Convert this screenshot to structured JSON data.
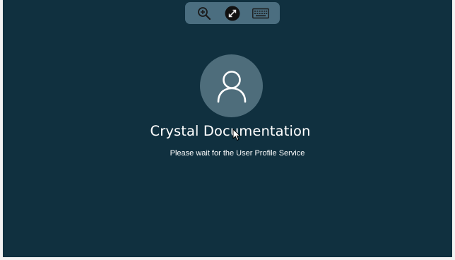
{
  "toolbar": {
    "buttons": [
      {
        "icon": "zoom-in-icon"
      },
      {
        "icon": "connection-icon"
      },
      {
        "icon": "keyboard-icon"
      }
    ]
  },
  "user": {
    "name": "Crystal Documentation",
    "status_message": "Please wait for the User Profile Service"
  },
  "colors": {
    "background": "#10303f",
    "toolbar": "#4b6e80",
    "avatar": "#4e6d7b",
    "text": "#ffffff"
  }
}
